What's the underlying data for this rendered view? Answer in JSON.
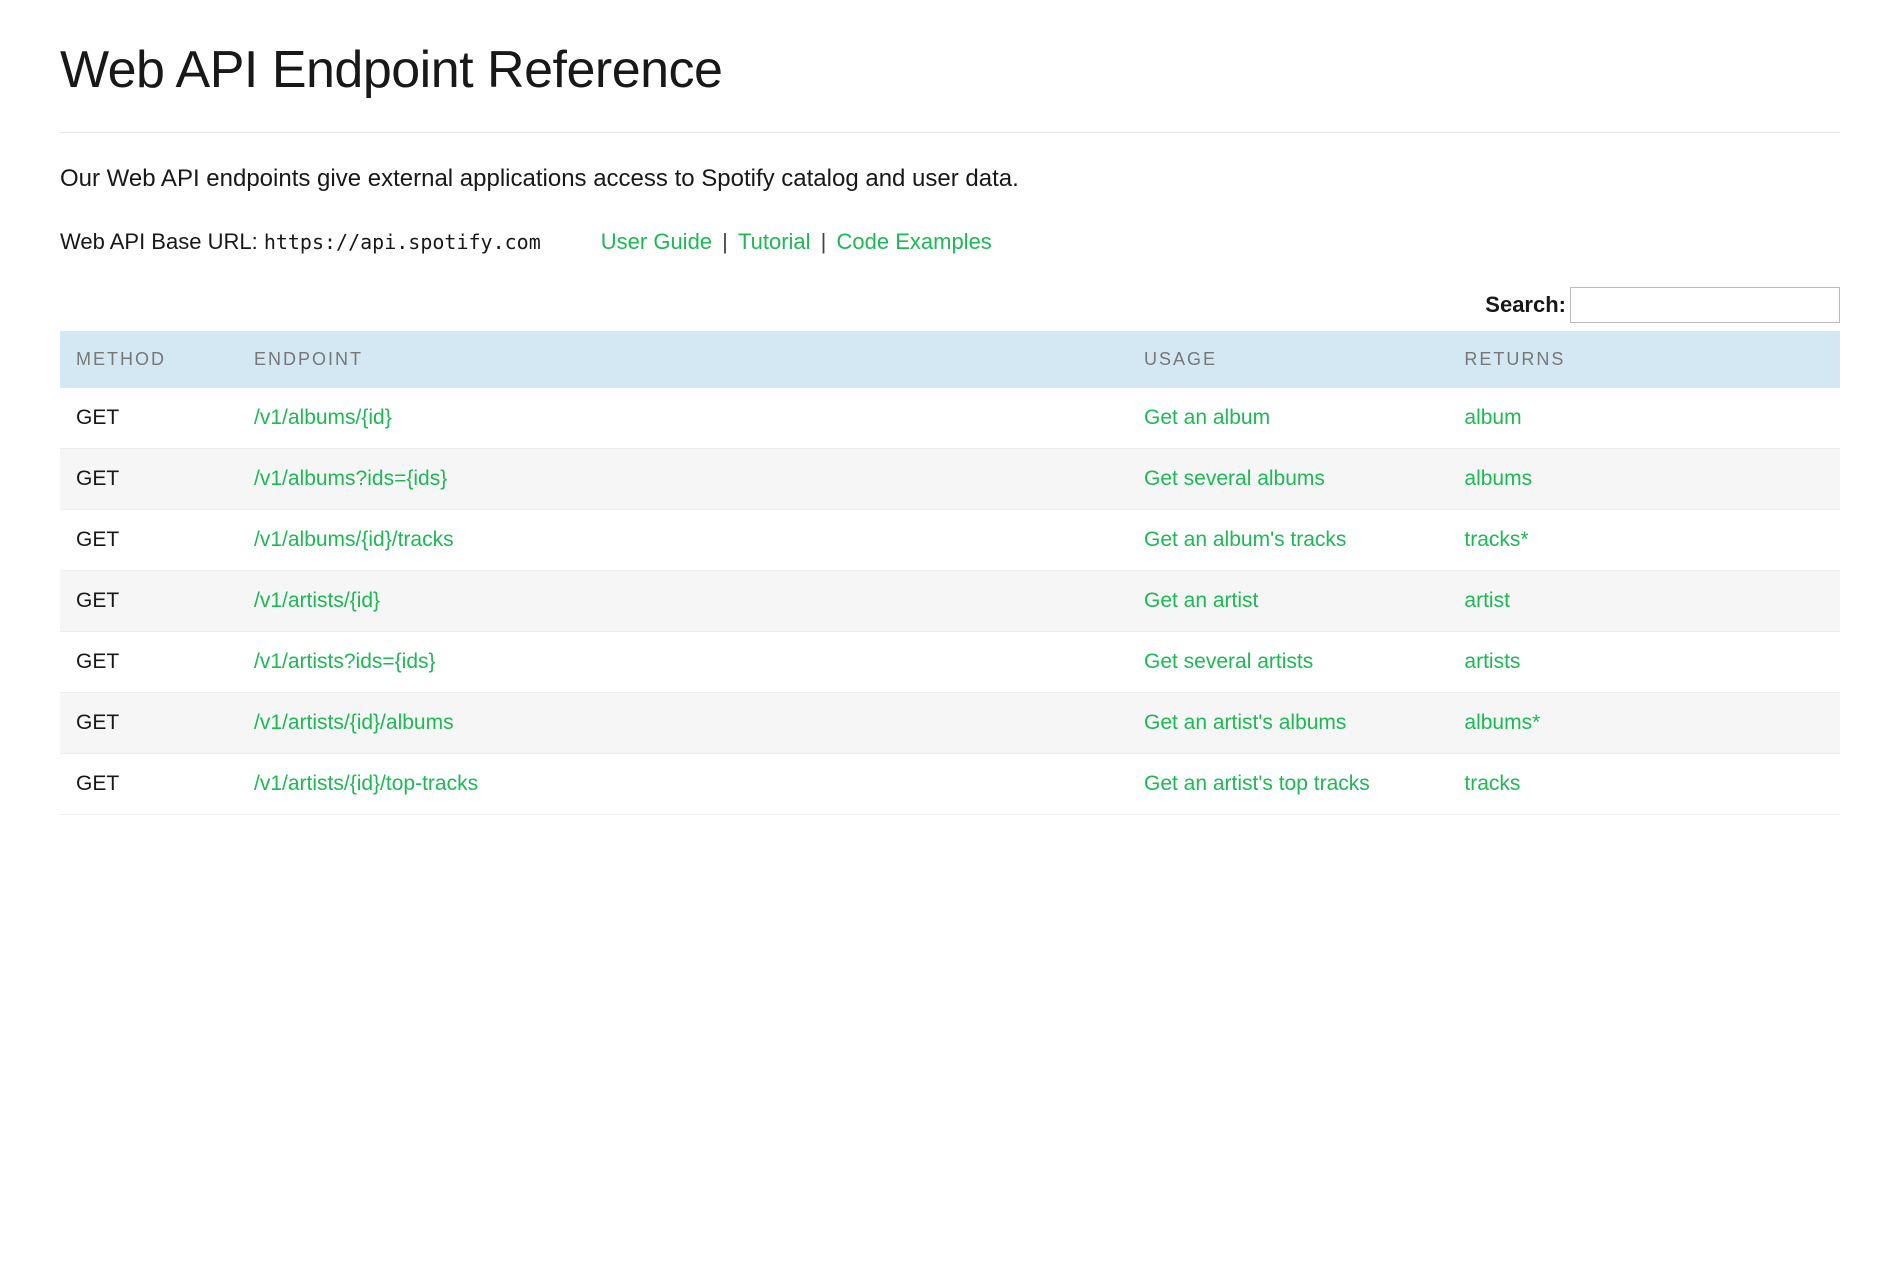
{
  "title": "Web API Endpoint Reference",
  "intro": "Our Web API endpoints give external applications access to Spotify catalog and user data.",
  "base_url": {
    "label": "Web API Base URL: ",
    "value": "https://api.spotify.com"
  },
  "doc_links": {
    "user_guide": "User Guide",
    "tutorial": "Tutorial",
    "code_examples": "Code Examples",
    "sep": " | "
  },
  "search": {
    "label": "Search:",
    "value": ""
  },
  "table": {
    "headers": {
      "method": "METHOD",
      "endpoint": "ENDPOINT",
      "usage": "USAGE",
      "returns": "RETURNS"
    },
    "rows": [
      {
        "method": "GET",
        "endpoint": "/v1/albums/{id}",
        "usage": "Get an album",
        "returns": "album"
      },
      {
        "method": "GET",
        "endpoint": "/v1/albums?ids={ids}",
        "usage": "Get several albums",
        "returns": "albums"
      },
      {
        "method": "GET",
        "endpoint": "/v1/albums/{id}/tracks",
        "usage": "Get an album's tracks",
        "returns": "tracks*"
      },
      {
        "method": "GET",
        "endpoint": "/v1/artists/{id}",
        "usage": "Get an artist",
        "returns": "artist"
      },
      {
        "method": "GET",
        "endpoint": "/v1/artists?ids={ids}",
        "usage": "Get several artists",
        "returns": "artists"
      },
      {
        "method": "GET",
        "endpoint": "/v1/artists/{id}/albums",
        "usage": "Get an artist's albums",
        "returns": "albums*"
      },
      {
        "method": "GET",
        "endpoint": "/v1/artists/{id}/top-tracks",
        "usage": "Get an artist's top tracks",
        "returns": "tracks"
      }
    ]
  }
}
